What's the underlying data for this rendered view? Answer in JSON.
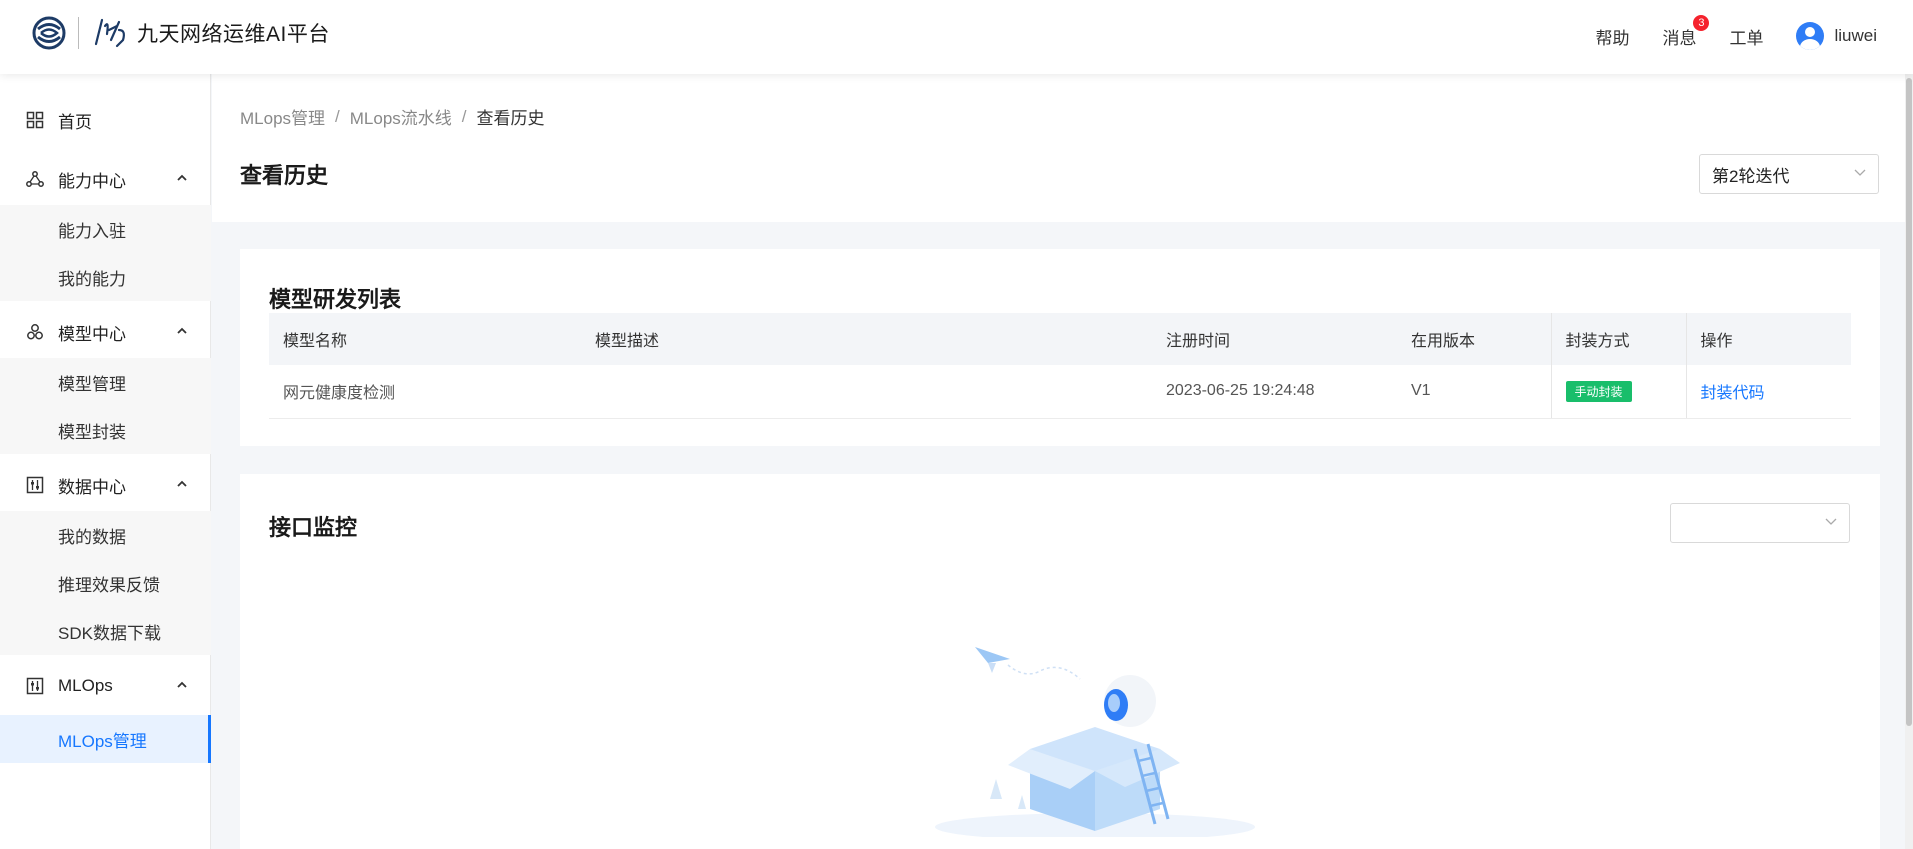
{
  "header": {
    "app_title": "九天网络运维AI平台",
    "help": "帮助",
    "messages": "消息",
    "message_count": "3",
    "tickets": "工单",
    "username": "liuwei"
  },
  "sidebar": {
    "home": "首页",
    "groups": [
      {
        "label": "能力中心",
        "items": [
          "能力入驻",
          "我的能力"
        ]
      },
      {
        "label": "模型中心",
        "items": [
          "模型管理",
          "模型封装"
        ]
      },
      {
        "label": "数据中心",
        "items": [
          "我的数据",
          "推理效果反馈",
          "SDK数据下载"
        ]
      },
      {
        "label": "MLOps",
        "items": [
          "MLOps管理"
        ]
      }
    ],
    "active_item": "MLOps管理"
  },
  "breadcrumb": [
    "MLops管理",
    "MLops流水线",
    "查看历史"
  ],
  "page": {
    "title": "查看历史",
    "iteration_select": "第2轮迭代"
  },
  "model_list": {
    "title": "模型研发列表",
    "columns": [
      "模型名称",
      "模型描述",
      "注册时间",
      "在用版本",
      "封装方式",
      "操作"
    ],
    "rows": [
      {
        "name": "网元健康度检测",
        "description": "",
        "registered": "2023-06-25 19:24:48",
        "version": "V1",
        "packaging": "手动封装",
        "action": "封装代码"
      }
    ]
  },
  "monitor": {
    "title": "接口监控",
    "select_value": ""
  },
  "colors": {
    "accent": "#1677ff",
    "tag_green": "#19be6b",
    "badge_red": "#f5222d"
  }
}
